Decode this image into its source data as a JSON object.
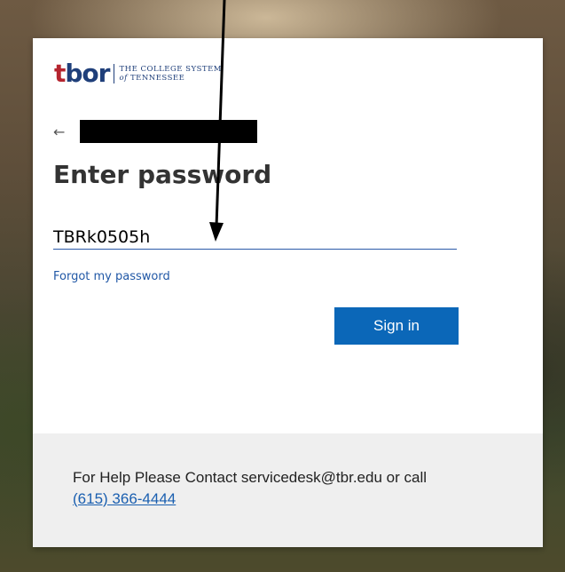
{
  "logo": {
    "mark": "bor",
    "mark_t": "t",
    "line1": "THE COLLEGE SYSTEM",
    "line2_italic": "of",
    "line2": "TENNESSEE"
  },
  "back": {
    "icon": "back-arrow-icon",
    "symbol": "←"
  },
  "title": "Enter password",
  "password": {
    "value": "TBRk0505h"
  },
  "forgot_link": "Forgot my password",
  "signin_button": "Sign in",
  "footer": {
    "help_text": "For Help Please Contact servicedesk@tbr.edu or call",
    "phone": "(615) 366-4444"
  },
  "colors": {
    "accent": "#0b67b8",
    "link": "#2158a6",
    "brand_blue": "#1f3f7a",
    "brand_red": "#b5252f"
  }
}
